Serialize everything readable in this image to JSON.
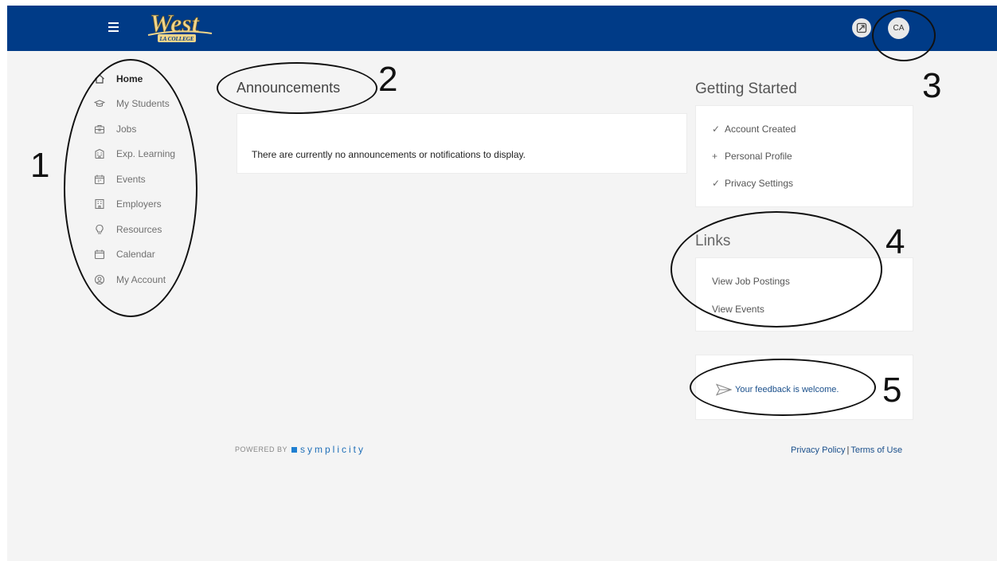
{
  "header": {
    "logo_main": "West",
    "logo_sub": "LA COLLEGE",
    "avatar_initials": "CA"
  },
  "sidebar": {
    "items": [
      {
        "label": "Home",
        "icon": "home-icon"
      },
      {
        "label": "My Students",
        "icon": "graduation-cap-icon"
      },
      {
        "label": "Jobs",
        "icon": "briefcase-icon"
      },
      {
        "label": "Exp. Learning",
        "icon": "building-icon"
      },
      {
        "label": "Events",
        "icon": "calendar-event-icon"
      },
      {
        "label": "Employers",
        "icon": "office-icon"
      },
      {
        "label": "Resources",
        "icon": "lightbulb-icon"
      },
      {
        "label": "Calendar",
        "icon": "calendar-icon"
      },
      {
        "label": "My Account",
        "icon": "user-circle-icon"
      }
    ]
  },
  "announcements": {
    "title": "Announcements",
    "empty_message": "There are currently no announcements or notifications to display."
  },
  "getting_started": {
    "title": "Getting Started",
    "items": [
      {
        "mark": "✓",
        "label": "Account Created"
      },
      {
        "mark": "+",
        "label": "Personal Profile"
      },
      {
        "mark": "✓",
        "label": "Privacy Settings"
      }
    ]
  },
  "links": {
    "title": "Links",
    "items": [
      "View Job Postings",
      "View Events"
    ]
  },
  "feedback": {
    "label": "Your feedback is welcome."
  },
  "footer": {
    "powered_by": "POWERED BY",
    "brand": "symplicity",
    "privacy": "Privacy Policy",
    "separator": "|",
    "terms": "Terms of Use"
  },
  "annotations": [
    "1",
    "2",
    "3",
    "4",
    "5"
  ],
  "colors": {
    "header_bg": "#003b87",
    "page_bg": "#f4f4f4",
    "link": "#1a4f8b"
  }
}
